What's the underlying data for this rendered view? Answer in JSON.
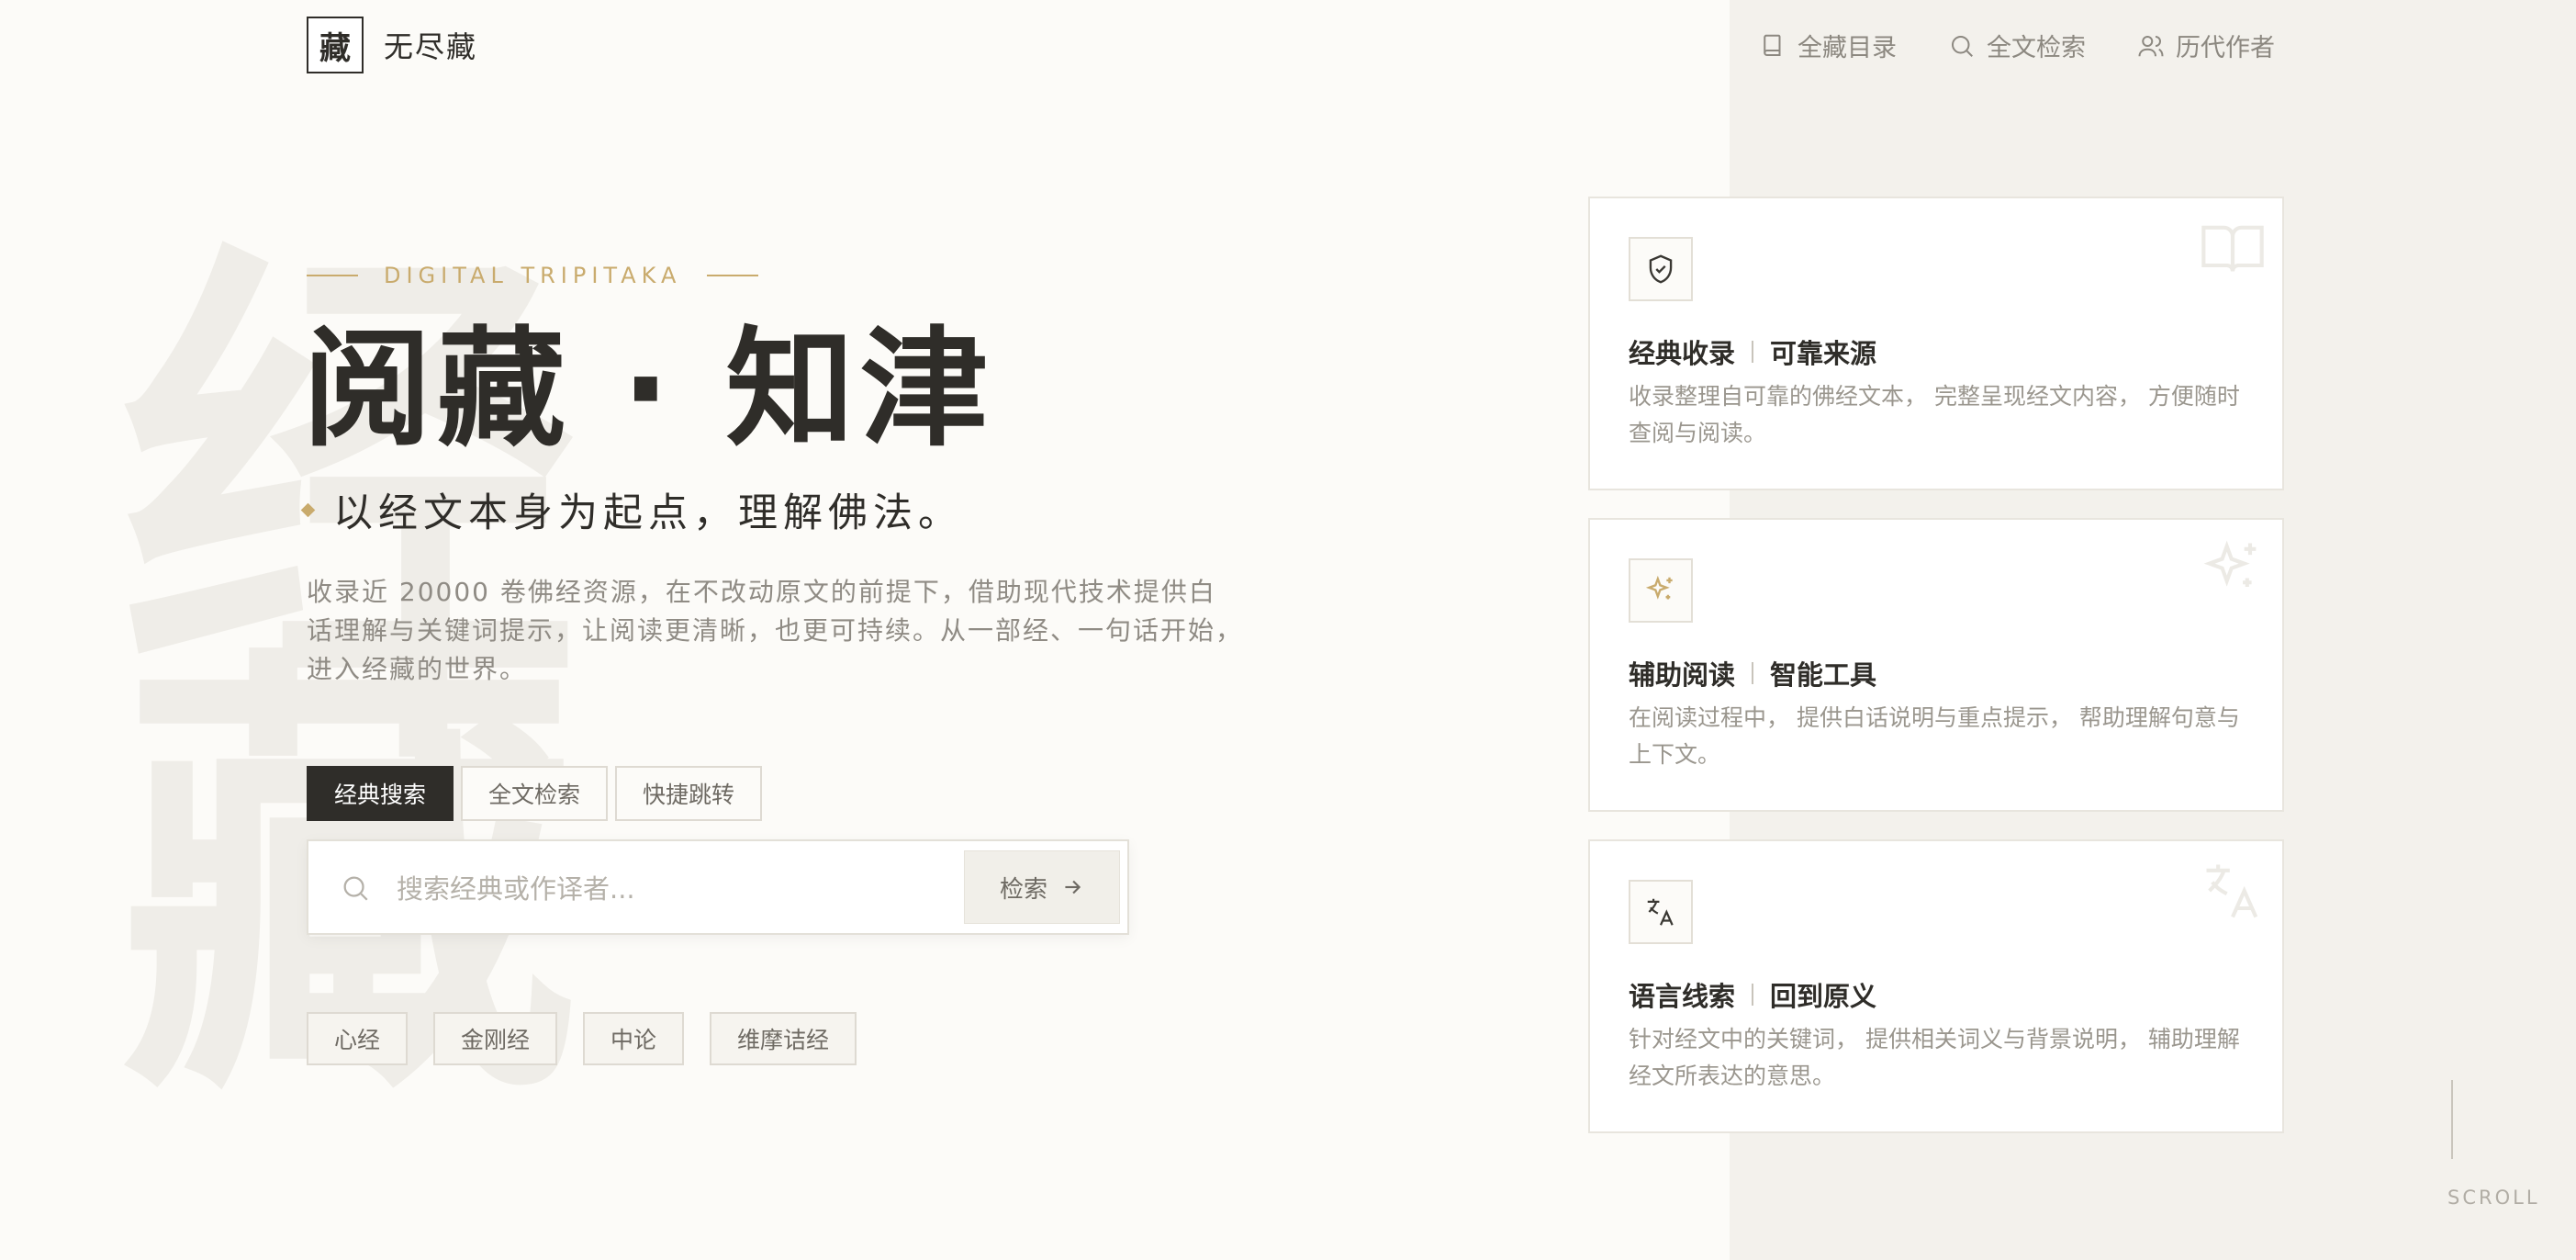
{
  "brand": {
    "logo_char": "藏",
    "name": "无尽藏"
  },
  "nav": [
    {
      "label": "全藏目录",
      "icon": "book-icon"
    },
    {
      "label": "全文检索",
      "icon": "search-icon"
    },
    {
      "label": "历代作者",
      "icon": "users-icon"
    }
  ],
  "hero": {
    "eyebrow": "DIGITAL TRIPITAKA",
    "title": "阅藏 · 知津",
    "subtitle": "以经文本身为起点，理解佛法。",
    "description": "收录近 20000 卷佛经资源，在不改动原文的前提下，借助现代技术提供白话理解与关键词提示，让阅读更清晰，也更可持续。从一部经、一句话开始，进入经藏的世界。",
    "watermark": [
      "经",
      "藏"
    ]
  },
  "search": {
    "tabs": [
      {
        "label": "经典搜索",
        "active": true
      },
      {
        "label": "全文检索",
        "active": false
      },
      {
        "label": "快捷跳转",
        "active": false
      }
    ],
    "placeholder": "搜索经典或作译者...",
    "value": "",
    "button_label": "检索",
    "quick_links": [
      "心经",
      "金刚经",
      "中论",
      "维摩诘经"
    ]
  },
  "features": [
    {
      "icon": "shield-check-icon",
      "bg_icon": "open-book-icon",
      "title_a": "经典收录",
      "title_b": "可靠来源",
      "text": "收录整理自可靠的佛经文本， 完整呈现经文内容， 方便随时查阅与阅读。"
    },
    {
      "icon": "sparkles-icon",
      "bg_icon": "sparkles-icon",
      "title_a": "辅助阅读",
      "title_b": "智能工具",
      "text": "在阅读过程中， 提供白话说明与重点提示， 帮助理解句意与上下文。"
    },
    {
      "icon": "translate-icon",
      "bg_icon": "translate-icon",
      "title_a": "语言线索",
      "title_b": "回到原义",
      "text": "针对经文中的关键词， 提供相关词义与背景说明， 辅助理解经文所表达的意思。"
    }
  ],
  "scroll_hint": "SCROLL",
  "colors": {
    "accent": "#c9ab6d",
    "ink": "#2f2d29",
    "muted": "#8f8b84",
    "panel": "#f3f1ec",
    "page": "#fcfbf8"
  }
}
